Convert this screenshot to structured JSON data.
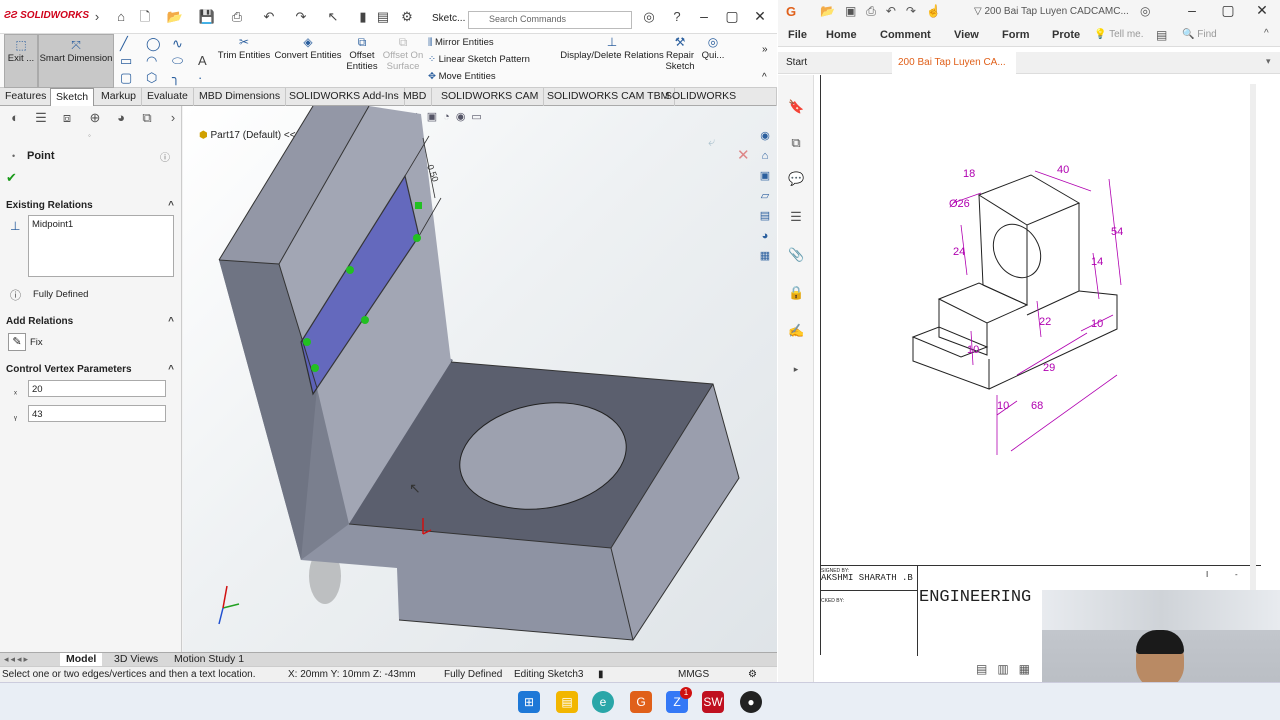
{
  "solidworks": {
    "app_name": "SOLIDWORKS",
    "doc_label": "Sketc...",
    "search_placeholder": "Search Commands",
    "ribbon": {
      "exit": "Exit ...",
      "smart_dimension": "Smart Dimension",
      "trim": "Trim Entities",
      "convert": "Convert Entities",
      "offset": "Offset Entities",
      "offset_surface": "Offset On Surface",
      "mirror": "Mirror Entities",
      "linear_pattern": "Linear Sketch Pattern",
      "move": "Move Entities",
      "display_relations": "Display/Delete Relations",
      "repair": "Repair Sketch",
      "quick": "Qui..."
    },
    "tabs": [
      "Features",
      "Sketch",
      "Markup",
      "Evaluate",
      "MBD Dimensions",
      "SOLIDWORKS Add-Ins",
      "MBD",
      "SOLIDWORKS CAM",
      "SOLIDWORKS CAM TBM",
      "SOLIDWORKS Inspection"
    ],
    "active_tab": "Sketch",
    "property_manager": {
      "title": "Point",
      "existing_relations_label": "Existing Relations",
      "existing_relations_item": "Midpoint1",
      "status": "Fully Defined",
      "add_relations_label": "Add Relations",
      "fix_label": "Fix",
      "cv_params_label": "Control Vertex Parameters",
      "x_value": "20",
      "y_value": "43"
    },
    "part_name": "Part17 (Default) <<...",
    "dimension_label": "0.50",
    "bottom_tabs": [
      "Model",
      "3D Views",
      "Motion Study 1"
    ],
    "status_bar": {
      "hint": "Select one or two edges/vertices and then a text location.",
      "coords": "X: 20mm Y: 10mm Z: -43mm",
      "defined": "Fully Defined",
      "editing": "Editing Sketch3",
      "units": "MMGS"
    }
  },
  "pdf": {
    "tab_title": "200 Bai Tap Luyen CADCAMC...",
    "menu": [
      "File",
      "Home",
      "Comment",
      "View",
      "Form",
      "Prote"
    ],
    "tell_me": "Tell me.",
    "find": "Find",
    "tabs": [
      "Start",
      "200 Bai Tap Luyen CA..."
    ],
    "dims": [
      "18",
      "40",
      "Ø26",
      "54",
      "24",
      "14",
      "22",
      "10",
      "10",
      "29",
      "10",
      "68"
    ],
    "title_block": {
      "designed_by": "AKSHMI SHARATH .B",
      "engineering": "ENGINEERING"
    }
  },
  "colors": {
    "accent": "#d0021b",
    "dim_color": "#b000b0",
    "model_gray": "#8e93a3",
    "sketch_face": "#5a5fbf"
  }
}
